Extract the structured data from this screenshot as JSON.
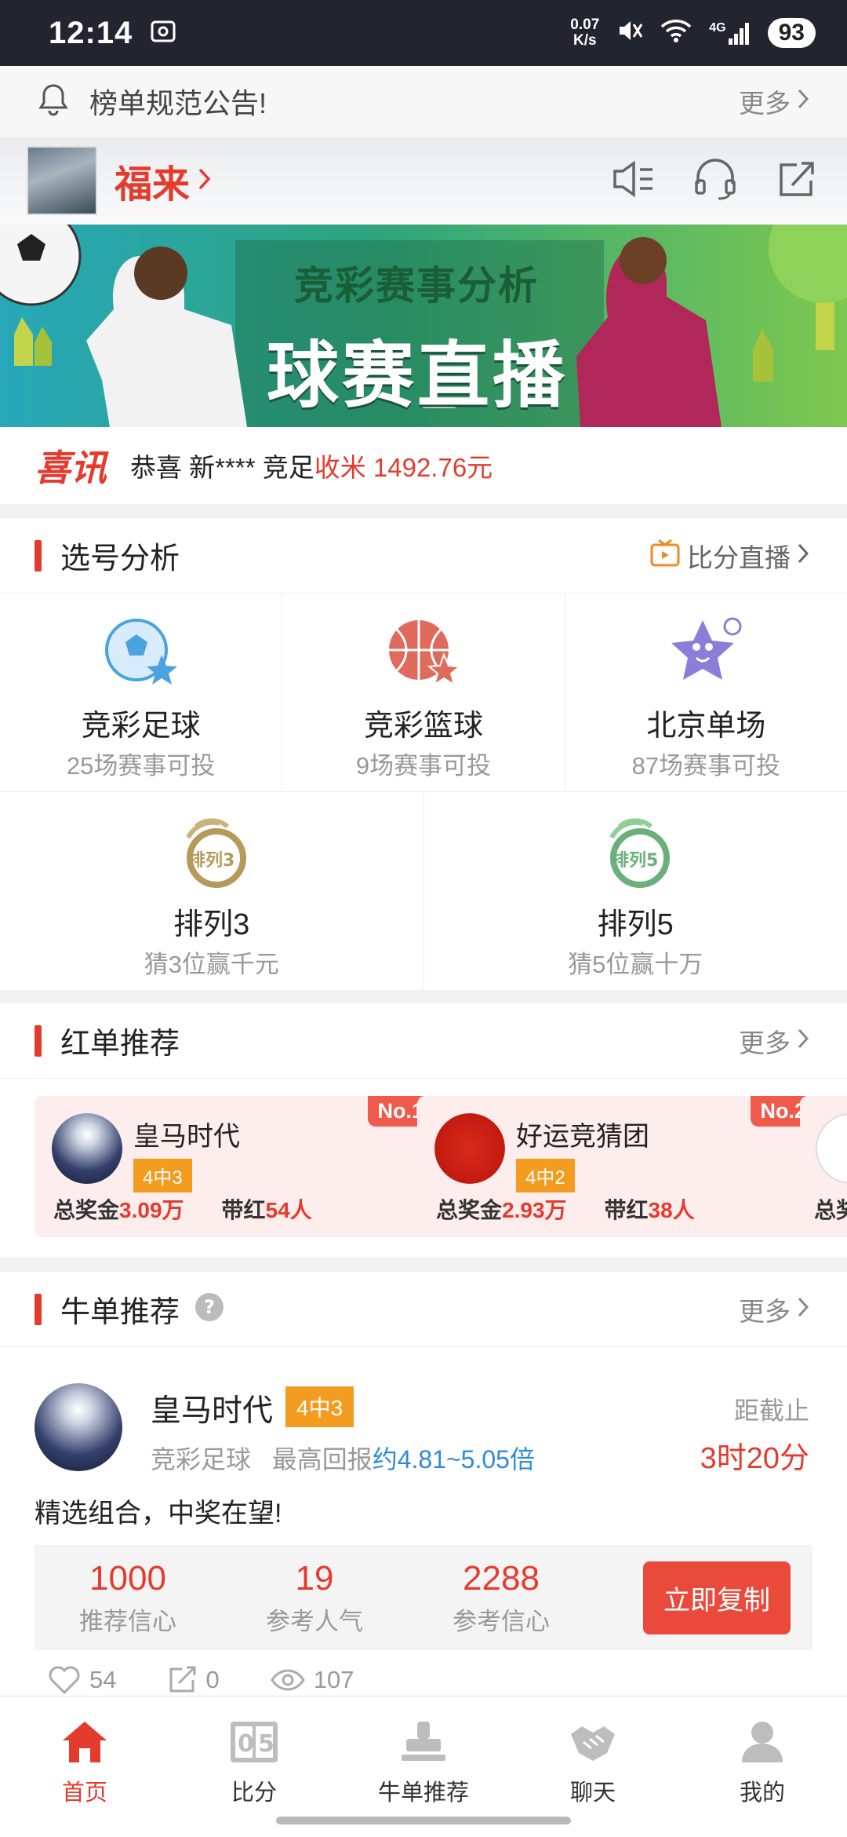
{
  "status_bar": {
    "time": "12:14",
    "net_speed": "0.07",
    "net_unit": "K/s",
    "signal": "4G",
    "battery": "93"
  },
  "notice": {
    "text": "榜单规范公告!",
    "more": "更多"
  },
  "store": {
    "name": "福来"
  },
  "banner": {
    "subtitle": "竞彩赛事分析",
    "title": "球赛直播"
  },
  "ticker": {
    "brand": "喜讯",
    "prefix": "恭喜 新****  竞足",
    "amount": "收米 1492.76元"
  },
  "analysis": {
    "title": "选号分析",
    "live_link": "比分直播",
    "games": [
      {
        "name": "竞彩足球",
        "sub": "25场赛事可投",
        "icon": "football-icon"
      },
      {
        "name": "竞彩篮球",
        "sub": "9场赛事可投",
        "icon": "basketball-icon"
      },
      {
        "name": "北京单场",
        "sub": "87场赛事可投",
        "icon": "star-icon"
      },
      {
        "name": "排列3",
        "sub": "猜3位赢千元",
        "icon": "pailie3-icon"
      },
      {
        "name": "排列5",
        "sub": "猜5位赢十万",
        "icon": "pailie5-icon"
      }
    ]
  },
  "red_list": {
    "title": "红单推荐",
    "more": "更多",
    "cards": [
      {
        "rank": "No.1",
        "name": "皇马时代",
        "badge": "4中3",
        "prize_label": "总奖金",
        "prize": "3.09万",
        "lead_label": "带红",
        "lead": "54人"
      },
      {
        "rank": "No.2",
        "name": "好运竞猜团",
        "badge": "4中2",
        "prize_label": "总奖金",
        "prize": "2.93万",
        "lead_label": "带红",
        "lead": "38人"
      },
      {
        "rank": "",
        "name": "",
        "badge": "",
        "prize_label": "总奖",
        "prize": "",
        "lead_label": "",
        "lead": ""
      }
    ]
  },
  "niu_list": {
    "title": "牛单推荐",
    "more": "更多",
    "item": {
      "name": "皇马时代",
      "badge": "4中3",
      "category": "竞彩足球",
      "return_label": "最高回报",
      "return_value": "约4.81~5.05倍",
      "deadline_label": "距截止",
      "deadline": "3时20分",
      "slogan": "精选组合，中奖在望!",
      "stats": [
        {
          "value": "1000",
          "label": "推荐信心"
        },
        {
          "value": "19",
          "label": "参考人气"
        },
        {
          "value": "2288",
          "label": "参考信心"
        }
      ],
      "copy_button": "立即复制",
      "likes": "54",
      "shares": "0",
      "views": "107"
    }
  },
  "tabbar": [
    {
      "label": "首页",
      "active": true
    },
    {
      "label": "比分",
      "active": false
    },
    {
      "label": "牛单推荐",
      "active": false
    },
    {
      "label": "聊天",
      "active": false
    },
    {
      "label": "我的",
      "active": false
    }
  ],
  "colors": {
    "accent": "#e43b2f",
    "badge": "#f39c1f",
    "link_blue": "#2f8bd8"
  }
}
